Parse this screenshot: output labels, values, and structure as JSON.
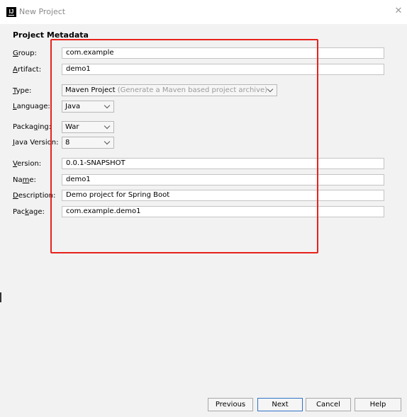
{
  "window": {
    "title": "New Project",
    "icon": "intellij-logo-icon",
    "close_icon": "close-icon"
  },
  "section_title": "Project Metadata",
  "form": {
    "group": {
      "label": "Group:",
      "mnemonic": "G",
      "rest": "roup:",
      "value": "com.example"
    },
    "artifact": {
      "label": "Artifact:",
      "mnemonic": "A",
      "rest": "rtifact:",
      "value": "demo1"
    },
    "type": {
      "label": "Type:",
      "mnemonic": "T",
      "rest": "ype:",
      "value": "Maven Project",
      "hint": "(Generate a Maven based project archive)"
    },
    "language": {
      "label": "Language:",
      "mnemonic": "L",
      "rest": "anguage:",
      "value": "Java"
    },
    "packaging": {
      "label": "Packaging:",
      "pre": "Packa",
      "mnemonic": "g",
      "rest": "ing:",
      "value": "War"
    },
    "java_version": {
      "label": "Java Version:",
      "mnemonic": "J",
      "rest": "ava Version:",
      "value": "8"
    },
    "version": {
      "label": "Version:",
      "mnemonic": "V",
      "rest": "ersion:",
      "value": "0.0.1-SNAPSHOT"
    },
    "name": {
      "label": "Name:",
      "pre": "Na",
      "mnemonic": "m",
      "rest": "e:",
      "value": "demo1"
    },
    "description": {
      "label": "Description:",
      "mnemonic": "D",
      "rest": "escription:",
      "value": "Demo project for Spring Boot"
    },
    "package": {
      "label": "Package:",
      "pre": "Pac",
      "mnemonic": "k",
      "rest": "age:",
      "value": "com.example.demo1"
    }
  },
  "buttons": {
    "previous": "Previous",
    "next": "Next",
    "cancel": "Cancel",
    "help": "Help"
  },
  "colors": {
    "highlight_box": "#e8211c",
    "primary_button_border": "#2f73c9",
    "background": "#f2f2f2"
  }
}
